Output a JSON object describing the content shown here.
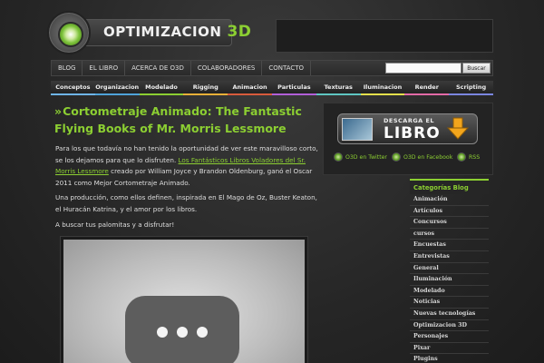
{
  "logo": {
    "text": "OPTIMIZACION",
    "accent": "3D"
  },
  "topnav": {
    "items": [
      "BLOG",
      "EL LIBRO",
      "ACERCA DE O3D",
      "COLABORADORES",
      "CONTACTO"
    ],
    "search_button": "Buscar",
    "search_placeholder": ""
  },
  "categories": [
    {
      "label": "Conceptos",
      "color": "#6fb5e8"
    },
    {
      "label": "Organizacion",
      "color": "#4fa3d9"
    },
    {
      "label": "Modelado",
      "color": "#8ccf32"
    },
    {
      "label": "Rigging",
      "color": "#e9b038"
    },
    {
      "label": "Animacion",
      "color": "#d85b3c"
    },
    {
      "label": "Particulas",
      "color": "#b25fd8"
    },
    {
      "label": "Texturas",
      "color": "#5fc6c2"
    },
    {
      "label": "Iluminacion",
      "color": "#e4e04c"
    },
    {
      "label": "Render",
      "color": "#e36aa7"
    },
    {
      "label": "Scripting",
      "color": "#7b86e0"
    }
  ],
  "post": {
    "title": "Cortometraje Animado: The Fantastic Flying Books of Mr. Morris Lessmore",
    "p1_a": "Para los que todavía no han tenido la oportunidad de ver este maravilloso corto, se los dejamos para que lo disfruten. ",
    "p1_link": "Los Fantásticos Libros Voladores del Sr. Morris Lessmore",
    "p1_b": " creado por William Joyce y Brandon Oldenburg, ganó el Oscar 2011 como Mejor Cortometraje Animado.",
    "p2": "Una producción, como ellos definen, inspirada en El Mago de Oz, Buster Keaton, el Huracán Katrina, y el amor por los libros.",
    "p3": "A buscar tus palomitas y a disfrutar!"
  },
  "sidebar": {
    "download_small": "DESCARGA EL",
    "download_big": "LIBRO",
    "social": [
      {
        "label": "O3D en Twitter"
      },
      {
        "label": "O3D en Facebook"
      },
      {
        "label": "RSS"
      }
    ],
    "categories_title": "Categorías Blog",
    "category_items": [
      "Animación",
      "Artículos",
      "Concursos",
      "cursos",
      "Encuestas",
      "Entrevistas",
      "General",
      "Iluminación",
      "Modelado",
      "Noticias",
      "Nuevas tecnologías",
      "Optimizacion 3D",
      "Personajes",
      "Pixar",
      "Plugins"
    ]
  }
}
